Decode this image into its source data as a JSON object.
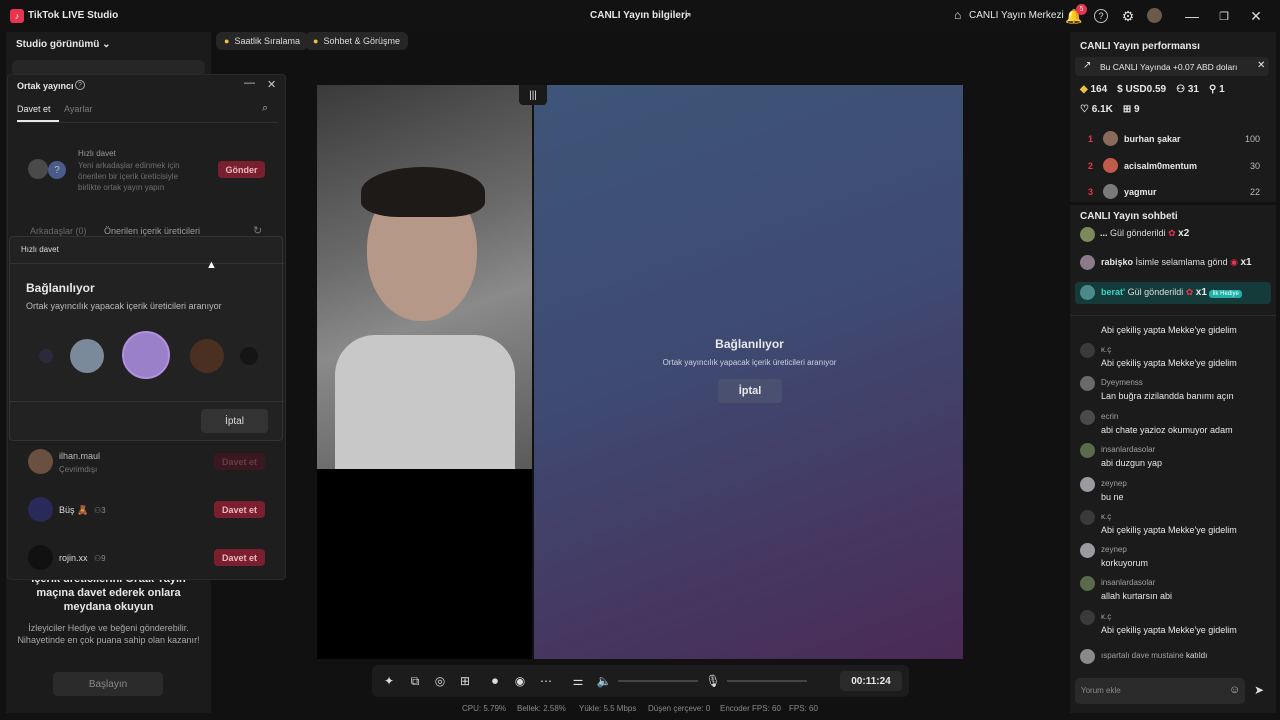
{
  "app": {
    "title": "TikTok LIVE Studio"
  },
  "header": {
    "live_info_label": "CANLI Yayın bilgileri",
    "live_center_label": "CANLI Yayın Merkezi",
    "notification_count": "5"
  },
  "left": {
    "studio_view_label": "Studio görünümü",
    "pills": [
      "Saatlik Sıralama",
      "Sohbet & Görüşme"
    ],
    "cohost": {
      "title": "Ortak yayıncı",
      "tabs": [
        "Davet et",
        "Ayarlar"
      ],
      "quick_invite_title": "Hızlı davet",
      "quick_invite_desc": "Yeni arkadaşlar edinmek için önerilen bir içerik üreticisiyle birlikte ortak yayın yapın",
      "send_label": "Gönder",
      "sub_tabs": [
        "Arkadaşlar (0)",
        "Önerilen içerik üreticileri"
      ],
      "users": [
        {
          "name": "ilhan.maul",
          "sub": "Çevrimdışı",
          "count": "",
          "button": "Davet et",
          "disabled": true
        },
        {
          "name": "Büş 🧸",
          "sub": "",
          "count": "3",
          "button": "Davet et",
          "disabled": false
        },
        {
          "name": "rojin.xx",
          "sub": "",
          "count": "9",
          "button": "Davet et",
          "disabled": false
        }
      ]
    },
    "popup": {
      "header": "Hızlı davet",
      "title": "Bağlanılıyor",
      "subtitle": "Ortak yayıncılık yapacak içerik üreticileri aranıyor",
      "cancel_label": "İptal"
    },
    "bottom": {
      "partial_line": "İçerik üreticilerini Ortak Yayın",
      "heading": "maçına davet ederek onlara meydana okuyun",
      "body": "İzleyiciler Hediye ve beğeni gönderebilir. Nihayetinde en çok puana sahip olan kazanır!",
      "start_label": "Başlayın"
    }
  },
  "stage": {
    "connecting_title": "Bağlanılıyor",
    "connecting_subtitle": "Ortak yayıncılık yapacak içerik üreticileri aranıyor",
    "cancel_label": "İptal",
    "timer": "00:11:24"
  },
  "stats": {
    "cpu": "CPU: 5.79%",
    "memory": "Bellek: 2.58%",
    "upload": "Yükle: 5.5 Mbps",
    "dropped": "Düşen çerçeve: 0",
    "encoder_fps": "Encoder FPS: 60",
    "fps": "FPS: 60"
  },
  "performance": {
    "title": "CANLI Yayın performansı",
    "banner": "Bu CANLI Yayında +0.07 ABD doları",
    "metrics": {
      "diamonds": "164",
      "usd": "USD0.59",
      "viewers": "31",
      "new_followers": "1",
      "likes": "6.1K",
      "gifters": "9"
    },
    "ranking": [
      {
        "rank": "1",
        "name": "burhan şakar",
        "score": "100"
      },
      {
        "rank": "2",
        "name": "acisalm0mentum",
        "score": "30"
      },
      {
        "rank": "3",
        "name": "yagmur",
        "score": "22"
      }
    ]
  },
  "chat": {
    "title": "CANLI Yayın sohbeti",
    "gifts": [
      {
        "user": "...",
        "text": "Gül gönderildi",
        "count": "x2"
      },
      {
        "user": "rabişko",
        "text": "İsimle selamlama gönd",
        "count": "x1"
      },
      {
        "user": "berat'",
        "text": "Gül gönderildi",
        "count": "x1",
        "badge": "İlk Hediye"
      }
    ],
    "messages": [
      {
        "user": "",
        "text": "Abi çekiliş yapta Mekke'ye gidelim"
      },
      {
        "user": "ĸ.ç",
        "text": "Abi çekiliş yapta Mekke'ye gidelim"
      },
      {
        "user": "Dyeymenss",
        "text": "Lan buğra zizilandda banımı açın"
      },
      {
        "user": "ecrin",
        "text": "abi chate yazioz okumuyor adam"
      },
      {
        "user": "insanlardasolar",
        "text": "abi duzgun yap"
      },
      {
        "user": "zeynep",
        "text": "bu ne"
      },
      {
        "user": "ĸ.ç",
        "text": "Abi çekiliş yapta Mekke'ye gidelim"
      },
      {
        "user": "zeynep",
        "text": "korkuyorum"
      },
      {
        "user": "insanlardasolar",
        "text": "allah kurtarsın abi"
      },
      {
        "user": "ĸ.ç",
        "text": "Abi çekiliş yapta Mekke'ye gidelim"
      }
    ],
    "join": {
      "user": "ıspartalı dave mustaine",
      "text": "katıldı"
    },
    "input_placeholder": "Yorum ekle"
  }
}
